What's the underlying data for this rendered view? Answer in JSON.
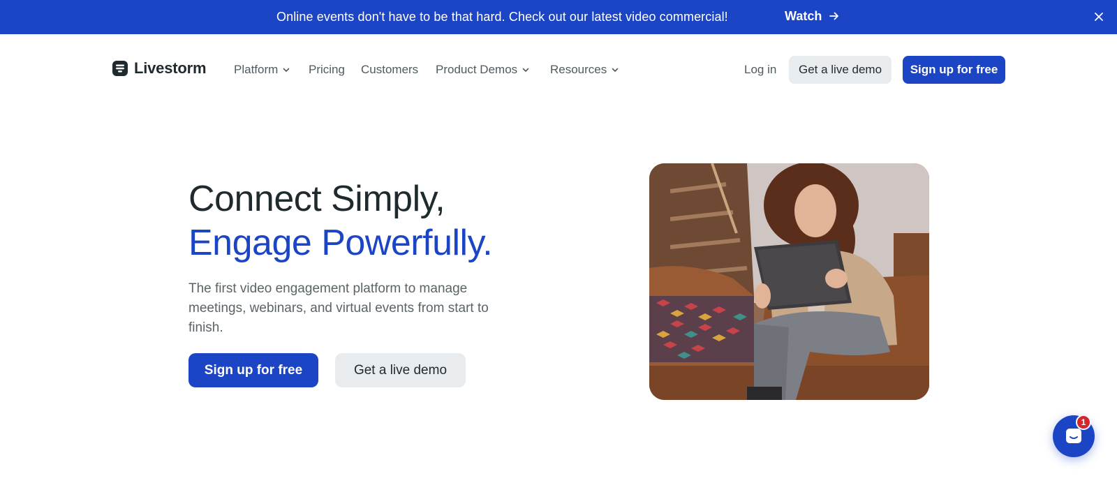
{
  "banner": {
    "text": "Online events don't have to be that hard. Check out our latest video commercial!",
    "link_label": "Watch",
    "arrow_icon": "arrow-right-icon",
    "close_icon": "close-icon"
  },
  "nav": {
    "logo_text": "Livestorm",
    "items": [
      {
        "label": "Platform",
        "has_dropdown": true
      },
      {
        "label": "Pricing",
        "has_dropdown": false
      },
      {
        "label": "Customers",
        "has_dropdown": false
      },
      {
        "label": "Product Demos",
        "has_dropdown": true
      },
      {
        "label": "Resources",
        "has_dropdown": true
      }
    ],
    "login_label": "Log in",
    "demo_label": "Get a live demo",
    "signup_label": "Sign up for free"
  },
  "hero": {
    "headline_line1": "Connect Simply,",
    "headline_line2": "Engage Powerfully.",
    "subtext": "The first video engagement platform to manage meetings, webinars, and virtual events from start to finish.",
    "primary_cta": "Sign up for free",
    "secondary_cta": "Get a live demo"
  },
  "chat": {
    "icon": "chat-bubble-icon",
    "badge_count": "1"
  },
  "colors": {
    "brand_blue": "#1b45c4",
    "text_dark": "#1f2a2e",
    "text_muted": "#5a6468",
    "ghost_button": "#e9ecef",
    "badge_red": "#d3272f"
  }
}
